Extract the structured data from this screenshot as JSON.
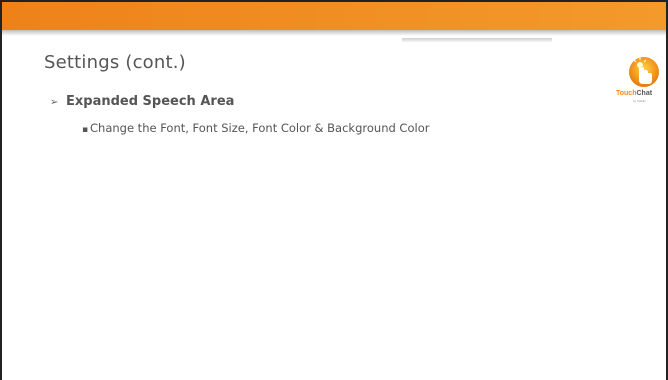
{
  "slide": {
    "title": "Settings (cont.)",
    "accent_color": "#f08a1c",
    "logo": {
      "name": "touchchat-logo-icon",
      "text_orange": "Touch",
      "text_dark": "Chat",
      "subtext": "by Saltillo"
    },
    "bullets": [
      {
        "marker": "➢",
        "text": "Expanded Speech Area",
        "sub": [
          {
            "marker": "▪",
            "text": "Change the Font, Font Size, Font Color & Background Color"
          }
        ]
      }
    ]
  }
}
